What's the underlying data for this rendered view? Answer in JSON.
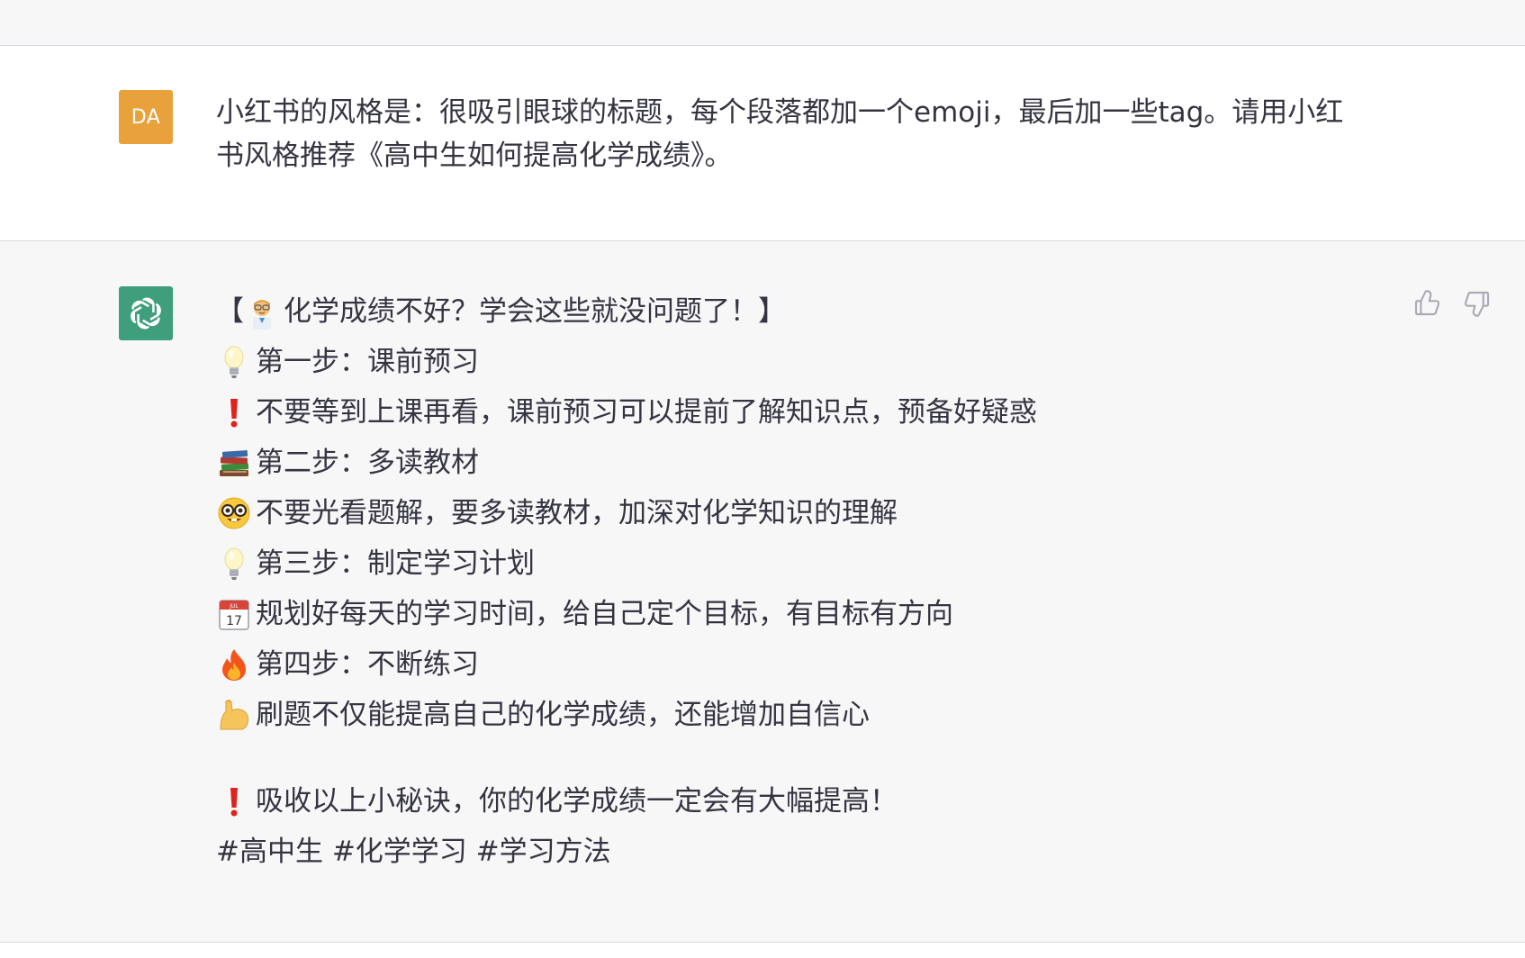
{
  "colors": {
    "user_avatar_bg": "#e9a23b",
    "bot_avatar_bg": "#3f9f7c",
    "text": "#343541",
    "feedback_icon": "#aaaab5"
  },
  "user_message": {
    "avatar_initials": "DA",
    "line1": "小红书的风格是：很吸引眼球的标题，每个段落都加一个emoji，最后加一些tag。请用小红",
    "line2": "书风格推荐《高中生如何提高化学成绩》。"
  },
  "assistant_message": {
    "avatar_icon": "openai-logo-icon",
    "title_open": "【",
    "title": "化学成绩不好？学会这些就没问题了！",
    "title_close": "】",
    "lines": [
      {
        "icon": "lightbulb-icon",
        "text": "第一步：课前预习"
      },
      {
        "icon": "exclamation-icon",
        "text": "不要等到上课再看，课前预习可以提前了解知识点，预备好疑惑"
      },
      {
        "icon": "books-icon",
        "text": "第二步：多读教材"
      },
      {
        "icon": "nerd-face-icon",
        "text": "不要光看题解，要多读教材，加深对化学知识的理解"
      },
      {
        "icon": "lightbulb-icon",
        "text": "第三步：制定学习计划"
      },
      {
        "icon": "calendar-icon",
        "text": "规划好每天的学习时间，给自己定个目标，有目标有方向"
      },
      {
        "icon": "fire-icon",
        "text": "第四步：不断练习"
      },
      {
        "icon": "flexed-biceps-icon",
        "text": "刷题不仅能提高自己的化学成绩，还能增加自信心"
      }
    ],
    "conclusion": {
      "icon": "exclamation-icon",
      "text": "吸收以上小秘诀，你的化学成绩一定会有大幅提高！"
    },
    "tags": "#高中生 #化学学习 #学习方法",
    "calendar_day": "17",
    "calendar_month": "JUL"
  },
  "actions": {
    "thumbs_up": "thumbs-up-icon",
    "thumbs_down": "thumbs-down-icon"
  }
}
